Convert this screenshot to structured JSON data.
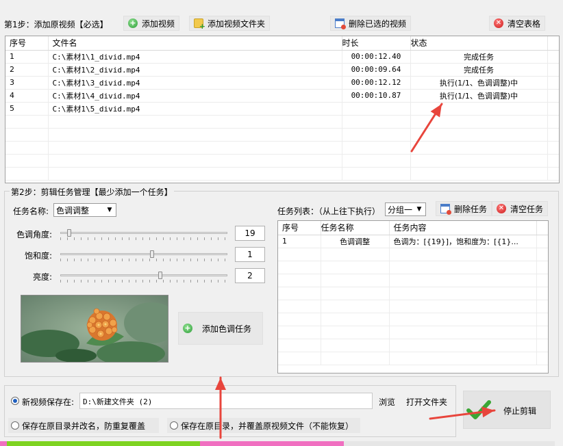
{
  "step1": {
    "title": "第1步：添加原视频【必选】",
    "add_video": "添加视频",
    "add_folder": "添加视频文件夹",
    "delete_selected": "删除已选的视频",
    "clear_table": "清空表格"
  },
  "video_table": {
    "columns": [
      "序号",
      "文件名",
      "时长",
      "状态"
    ],
    "rows": [
      {
        "index": "1",
        "file": "C:\\素材1\\1_divid.mp4",
        "duration": "00:00:12.40",
        "status": "完成任务"
      },
      {
        "index": "2",
        "file": "C:\\素材1\\2_divid.mp4",
        "duration": "00:00:09.64",
        "status": "完成任务"
      },
      {
        "index": "3",
        "file": "C:\\素材1\\3_divid.mp4",
        "duration": "00:00:12.12",
        "status": "执行(1/1、色调调整)中"
      },
      {
        "index": "4",
        "file": "C:\\素材1\\4_divid.mp4",
        "duration": "00:00:10.87",
        "status": "执行(1/1、色调调整)中"
      },
      {
        "index": "5",
        "file": "C:\\素材1\\5_divid.mp4",
        "duration": "",
        "status": ""
      }
    ]
  },
  "step2": {
    "title": "第2步：剪辑任务管理【最少添加一个任务】",
    "task_name_label": "任务名称:",
    "task_name_value": "色调调整",
    "hue_label": "色调角度:",
    "hue_value": "19",
    "saturation_label": "饱和度:",
    "saturation_value": "1",
    "brightness_label": "亮度:",
    "brightness_value": "2",
    "add_task": "添加色调任务",
    "task_list_label": "任务列表：（从上往下执行）",
    "group_value": "分组一",
    "delete_task": "删除任务",
    "clear_tasks": "清空任务"
  },
  "sliders": {
    "hue_fraction": 0.04,
    "saturation_fraction": 0.55,
    "brightness_fraction": 0.6
  },
  "task_table": {
    "columns": [
      "序号",
      "任务名称",
      "任务内容"
    ],
    "rows": [
      {
        "index": "1",
        "name": "色调调整",
        "content": "色调为：[{19}]，饱和度为：[{1}..."
      }
    ]
  },
  "output": {
    "save_new_label": "新视频保存在:",
    "save_path": "D:\\新建文件夹 (2)",
    "browse": "浏览",
    "open_folder": "打开文件夹",
    "rename_option": "保存在原目录并改名，防重复覆盖",
    "overwrite_option": "保存在原目录，并覆盖原视频文件（不能恢复）",
    "stop_button": "停止剪辑"
  },
  "progress": {
    "green_fraction": 0.36,
    "pink_fraction": 0.62
  },
  "colors": {
    "accent_red": "#e8453c",
    "progress_green": "#7ed321",
    "progress_pink": "#f06fc0"
  }
}
